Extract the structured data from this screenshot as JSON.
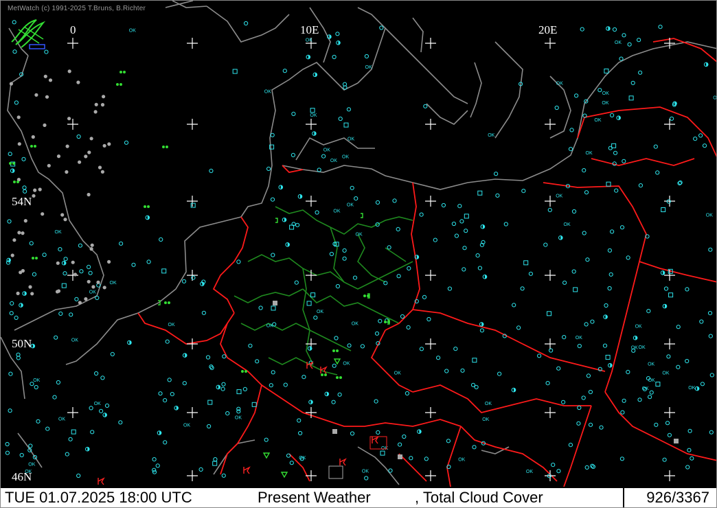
{
  "app": {
    "copyright": "MetWatch  (c) 1991-2025 T.Bruns, B.Richter"
  },
  "map": {
    "lon_labels": [
      "0",
      "10E",
      "20E"
    ],
    "lat_labels": [
      "54N",
      "50N",
      "46N"
    ],
    "colors": {
      "background": "#000000",
      "coastline": "#8c8c8c",
      "country_border": "#ff1a1a",
      "state_border": "#1f8a1f",
      "station": "#2ee6ee",
      "weather_green": "#33dd33",
      "weather_red": "#ff2222",
      "grid_cross": "#ffffff"
    },
    "station_label": "OK",
    "icons": [
      "station-circle-icon",
      "cloud-cover-icon",
      "rain-icon",
      "thunderstorm-icon",
      "shower-icon",
      "drizzle-icon",
      "logo-icon"
    ]
  },
  "statusbar": {
    "datetime": "TUE 01.07.2025 18:00 UTC",
    "product": "Present Weather",
    "overlay": ", Total Cloud Cover",
    "count": "926/3367"
  }
}
